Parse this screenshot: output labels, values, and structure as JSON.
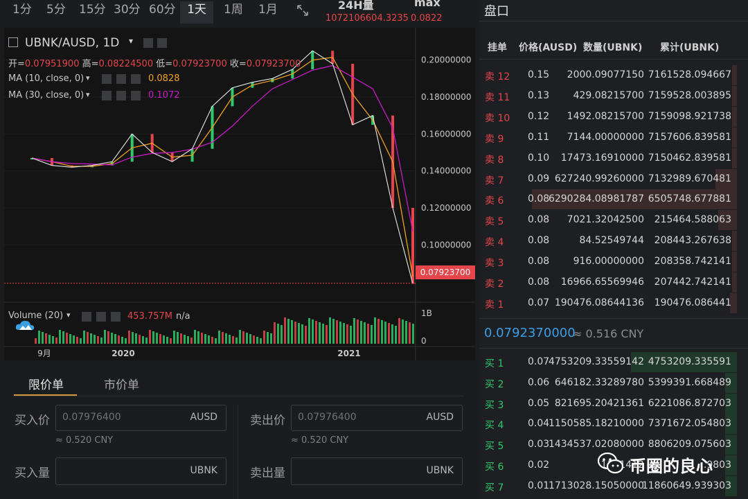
{
  "timeframes": {
    "items": [
      "1分",
      "5分",
      "15分",
      "30分",
      "60分",
      "1天",
      "1周",
      "1月"
    ],
    "active": "1天"
  },
  "stats": {
    "vol_label": "24H量",
    "vol_value": "1072106604.3235",
    "max_label": "max",
    "max_value": "0.0822"
  },
  "chart": {
    "symbol": "UBNK/AUSD, 1D",
    "ohlc": {
      "open_label": "开=",
      "open": "0.07951900",
      "high_label": "高=",
      "high": "0.08224500",
      "low_label": "低=",
      "low": "0.07923700",
      "close_label": "收=",
      "close": "0.07923700"
    },
    "ma10": {
      "label": "MA (10, close, 0)",
      "value": "0.0828"
    },
    "ma30": {
      "label": "MA (30, close, 0)",
      "value": "0.1072"
    },
    "last_price": "0.07923700",
    "y_ticks": [
      "0.20000000",
      "0.18000000",
      "0.16000000",
      "0.14000000",
      "0.12000000",
      "0.10000000"
    ],
    "volume": {
      "label": "Volume (20)",
      "value": "453.757M",
      "suffix": "n/a",
      "ticks": [
        "1B",
        "0"
      ]
    },
    "x_ticks": [
      "9月",
      "2020",
      "2021"
    ]
  },
  "chart_data": {
    "type": "line",
    "title": "UBNK/AUSD, 1D",
    "x": [
      "2019-09",
      "2019-10",
      "2019-11",
      "2019-12",
      "2020-01",
      "2020-02",
      "2020-03",
      "2020-04",
      "2020-05",
      "2020-06",
      "2020-07",
      "2020-08",
      "2020-09",
      "2020-10",
      "2020-11",
      "2020-12",
      "2021-01",
      "2021-02",
      "2021-03",
      "2021-04"
    ],
    "series": [
      {
        "name": "close",
        "values": [
          0.147,
          0.143,
          0.142,
          0.143,
          0.145,
          0.16,
          0.15,
          0.145,
          0.152,
          0.175,
          0.185,
          0.188,
          0.19,
          0.195,
          0.205,
          0.198,
          0.165,
          0.17,
          0.12,
          0.079
        ]
      }
    ],
    "ylim": [
      0.075,
      0.21
    ],
    "ma10": 0.0828,
    "ma30": 0.1072
  },
  "order_form": {
    "tabs": [
      "限价单",
      "市价单"
    ],
    "active_tab": "限价单",
    "buy": {
      "price_label": "买入价",
      "price_placeholder": "0.07976400",
      "price_unit": "AUSD",
      "cny": "≈ 0.520 CNY",
      "qty_label": "买入量",
      "qty_unit": "UBNK"
    },
    "sell": {
      "price_label": "卖出价",
      "price_placeholder": "0.07976400",
      "price_unit": "AUSD",
      "cny": "≈ 0.520 CNY",
      "qty_label": "卖出量",
      "qty_unit": "UBNK"
    }
  },
  "book": {
    "title": "盘口",
    "headers": [
      "挂单",
      "价格(AUSD)",
      "数量(UBNK)",
      "累计(UBNK)"
    ],
    "asks": [
      {
        "label": "卖 12",
        "price": "0.15",
        "qty": "2000.09077150",
        "total": "7161528.094667"
      },
      {
        "label": "卖 11",
        "price": "0.13",
        "qty": "429.08215700",
        "total": "7159528.003895"
      },
      {
        "label": "卖 10",
        "price": "0.12",
        "qty": "1492.08215700",
        "total": "7159098.921738"
      },
      {
        "label": "卖 9",
        "price": "0.11",
        "qty": "7144.00000000",
        "total": "7157606.839581"
      },
      {
        "label": "卖 8",
        "price": "0.10",
        "qty": "17473.16910000",
        "total": "7150462.839581"
      },
      {
        "label": "卖 7",
        "price": "0.09",
        "qty": "627240.99260000",
        "total": "7132989.670481"
      },
      {
        "label": "卖 6",
        "price": "0.08",
        "qty": "6290284.08981787",
        "total": "6505748.677881"
      },
      {
        "label": "卖 5",
        "price": "0.08",
        "qty": "7021.32042500",
        "total": "215464.588063"
      },
      {
        "label": "卖 4",
        "price": "0.08",
        "qty": "84.52549744",
        "total": "208443.267638"
      },
      {
        "label": "卖 3",
        "price": "0.08",
        "qty": "916.00000000",
        "total": "208358.742141"
      },
      {
        "label": "卖 2",
        "price": "0.08",
        "qty": "16966.65569946",
        "total": "207442.742141"
      },
      {
        "label": "卖 1",
        "price": "0.07",
        "qty": "190476.08644136",
        "total": "190476.086441"
      }
    ],
    "mid_price": "0.0792370000",
    "mid_cny": "≈ 0.516 CNY",
    "bids": [
      {
        "label": "买 1",
        "price": "0.07",
        "qty": "4753209.33559142",
        "total": "4753209.335591"
      },
      {
        "label": "买 2",
        "price": "0.06",
        "qty": "646182.33289780",
        "total": "5399391.668489"
      },
      {
        "label": "买 3",
        "price": "0.05",
        "qty": "821695.20421361",
        "total": "6221086.872703"
      },
      {
        "label": "买 4",
        "price": "0.04",
        "qty": "1150585.18210000",
        "total": "7371672.054803"
      },
      {
        "label": "买 5",
        "price": "0.03",
        "qty": "1434537.02080000",
        "total": "8806209.075603"
      },
      {
        "label": "买 6",
        "price": "0.02",
        "qty": "1341412",
        "total": "...9803"
      },
      {
        "label": "买 7",
        "price": "0.01",
        "qty": "1713028.15050000",
        "total": "11860649.939303"
      }
    ],
    "ask_depth": [
      0.02,
      0.02,
      0.02,
      0.02,
      0.02,
      0.09,
      0.87,
      0.08,
      0.02,
      0.02,
      0.02,
      0.03
    ],
    "bid_depth": [
      0.45,
      0.05,
      0.05,
      0.05,
      0.05,
      0.05,
      0.05
    ],
    "colors": {
      "ask": "#e5454b",
      "bid": "#2fc86b",
      "ask_depth": "#3a2a2b",
      "bid_depth": "#1f3a2a"
    }
  },
  "watermark": {
    "text": "币圈的良心"
  }
}
